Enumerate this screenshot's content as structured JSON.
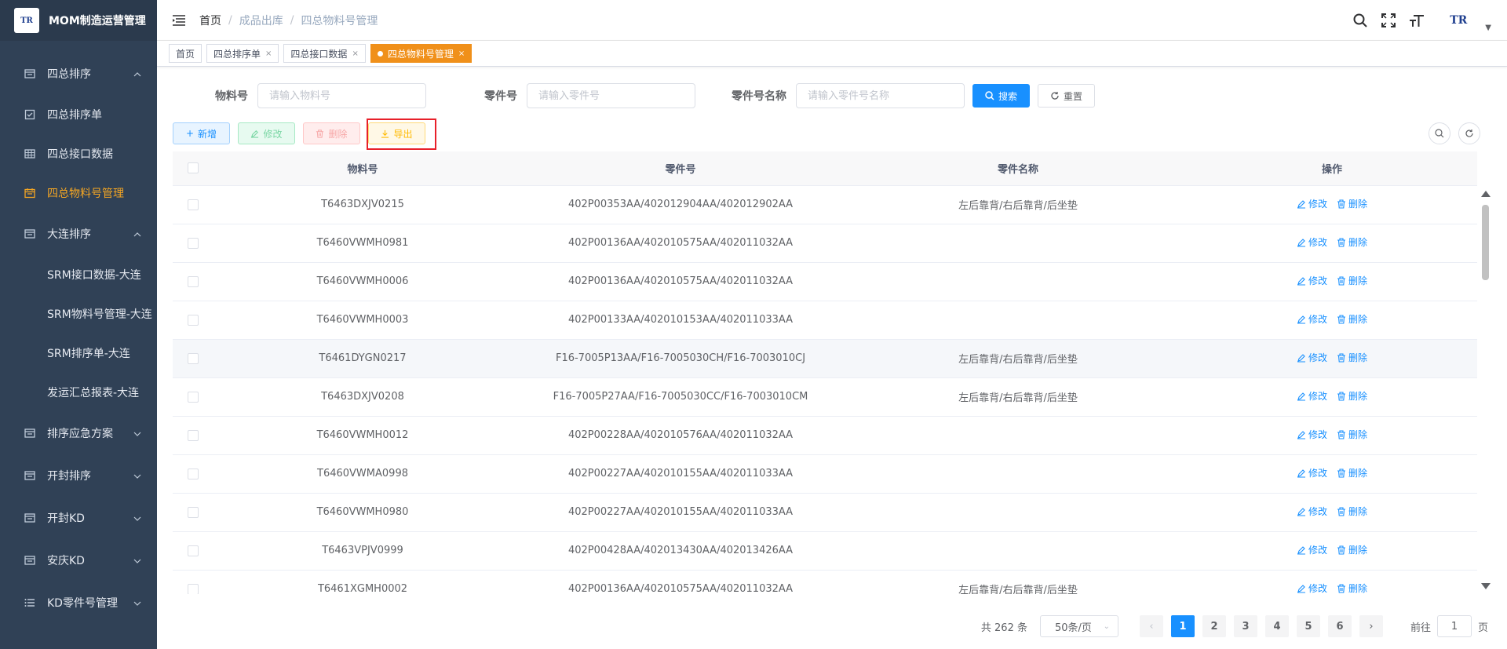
{
  "app": {
    "logo_text": "TR",
    "title": "MOM制造运营管理"
  },
  "sidebar": {
    "items": [
      {
        "label": "四总排序",
        "icon": "list-icon",
        "kind": "group-open"
      },
      {
        "label": "四总排序单",
        "icon": "checkbox-icon",
        "kind": "leaf"
      },
      {
        "label": "四总接口数据",
        "icon": "table-icon",
        "kind": "leaf"
      },
      {
        "label": "四总物料号管理",
        "icon": "calendar-icon",
        "kind": "leaf-active"
      },
      {
        "label": "大连排序",
        "icon": "list-icon",
        "kind": "group-open"
      },
      {
        "label": "SRM接口数据-大连",
        "kind": "sub"
      },
      {
        "label": "SRM物料号管理-大连",
        "kind": "sub"
      },
      {
        "label": "SRM排序单-大连",
        "kind": "sub"
      },
      {
        "label": "发运汇总报表-大连",
        "kind": "sub"
      },
      {
        "label": "排序应急方案",
        "icon": "list-icon",
        "kind": "group-closed"
      },
      {
        "label": "开封排序",
        "icon": "list-icon",
        "kind": "group-closed"
      },
      {
        "label": "开封KD",
        "icon": "list-icon",
        "kind": "group-closed"
      },
      {
        "label": "安庆KD",
        "icon": "list-icon",
        "kind": "group-closed"
      },
      {
        "label": "KD零件号管理",
        "icon": "bullet-list-icon",
        "kind": "group-closed"
      }
    ]
  },
  "breadcrumb": [
    "首页",
    "成品出库",
    "四总物料号管理"
  ],
  "tags": [
    {
      "label": "首页",
      "closable": false,
      "active": false
    },
    {
      "label": "四总排序单",
      "closable": true,
      "active": false
    },
    {
      "label": "四总接口数据",
      "closable": true,
      "active": false
    },
    {
      "label": "四总物料号管理",
      "closable": true,
      "active": true
    }
  ],
  "search": {
    "material_label": "物料号",
    "material_placeholder": "请输入物料号",
    "part_label": "零件号",
    "part_placeholder": "请输入零件号",
    "partname_label": "零件号名称",
    "partname_placeholder": "请输入零件号名称",
    "search_btn": "搜索",
    "reset_btn": "重置"
  },
  "toolbar": {
    "add": "新增",
    "edit": "修改",
    "delete": "删除",
    "export": "导出"
  },
  "table": {
    "headers": [
      "物料号",
      "零件号",
      "零件名称",
      "操作"
    ],
    "op_edit": "修改",
    "op_delete": "删除",
    "rows": [
      [
        "T6463DXJV0215",
        "402P00353AA/402012904AA/402012902AA",
        "左后靠背/右后靠背/后坐垫"
      ],
      [
        "T6460VWMH0981",
        "402P00136AA/402010575AA/402011032AA",
        ""
      ],
      [
        "T6460VWMH0006",
        "402P00136AA/402010575AA/402011032AA",
        ""
      ],
      [
        "T6460VWMH0003",
        "402P00133AA/402010153AA/402011033AA",
        ""
      ],
      [
        "T6461DYGN0217",
        "F16-7005P13AA/F16-7005030CH/F16-7003010CJ",
        "左后靠背/右后靠背/后坐垫"
      ],
      [
        "T6463DXJV0208",
        "F16-7005P27AA/F16-7005030CC/F16-7003010CM",
        "左后靠背/右后靠背/后坐垫"
      ],
      [
        "T6460VWMH0012",
        "402P00228AA/402010576AA/402011032AA",
        ""
      ],
      [
        "T6460VWMA0998",
        "402P00227AA/402010155AA/402011033AA",
        ""
      ],
      [
        "T6460VWMH0980",
        "402P00227AA/402010155AA/402011033AA",
        ""
      ],
      [
        "T6463VPJV0999",
        "402P00428AA/402013430AA/402013426AA",
        ""
      ],
      [
        "T6461XGMH0002",
        "402P00136AA/402010575AA/402011032AA",
        "左后靠背/右后靠背/后坐垫"
      ]
    ]
  },
  "pagination": {
    "total": "共 262 条",
    "page_size": "50条/页",
    "pages": [
      "1",
      "2",
      "3",
      "4",
      "5",
      "6"
    ],
    "current": "1",
    "goto_label": "前往",
    "goto_value": "1",
    "goto_suffix": "页"
  }
}
